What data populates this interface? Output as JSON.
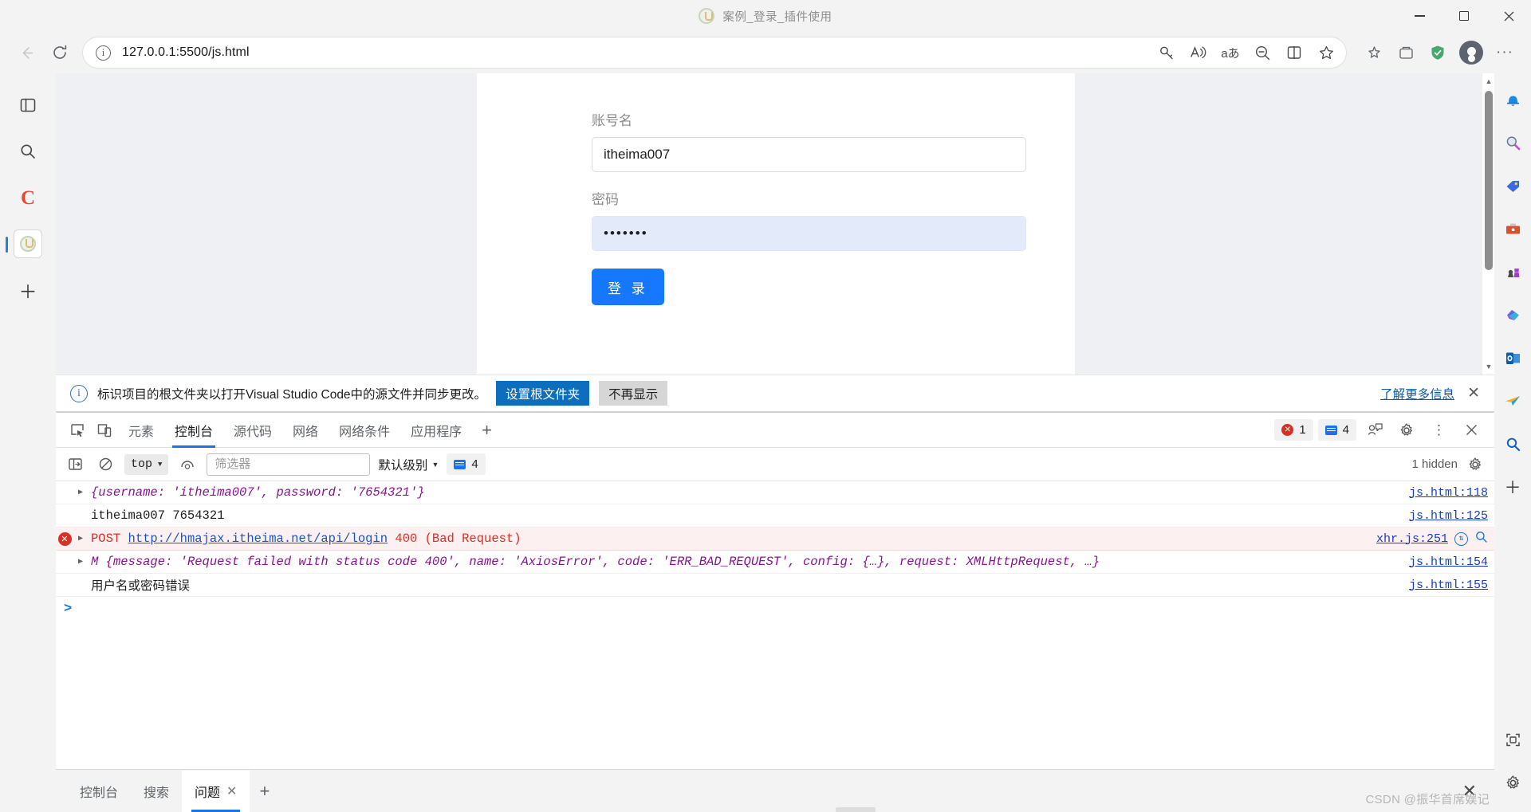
{
  "window": {
    "title": "案例_登录_插件使用",
    "favicon_name": "page-favicon",
    "minimize": "—",
    "maximize": "□",
    "close": "✕"
  },
  "navbar": {
    "back_icon": "back-arrow-icon",
    "reload_icon": "reload-icon",
    "url": "127.0.0.1:5500/js.html",
    "info_glyph": "i",
    "actions": [
      {
        "name": "password-key-icon",
        "glyph": "🔑"
      },
      {
        "name": "read-aloud-icon",
        "glyph": "A"
      },
      {
        "name": "translate-icon",
        "glyph": "aあ"
      },
      {
        "name": "zoom-out-icon",
        "glyph": "－"
      },
      {
        "name": "split-screen-icon",
        "glyph": "▯"
      },
      {
        "name": "add-favorite-icon",
        "glyph": "☆"
      }
    ],
    "right_actions": [
      {
        "name": "collections-icon",
        "glyph": "✦"
      },
      {
        "name": "browser-essentials-icon",
        "glyph": "▣"
      },
      {
        "name": "shield-icon",
        "glyph": "🛡"
      }
    ],
    "more_glyph": "···"
  },
  "left_rail": {
    "items": [
      {
        "name": "split-pane-icon",
        "glyph": "▯"
      },
      {
        "name": "search-icon",
        "glyph": "🔍"
      },
      {
        "name": "copilot-c-icon",
        "glyph": "C"
      },
      {
        "name": "site-tab-icon",
        "glyph": "●"
      },
      {
        "name": "add-tab-icon",
        "glyph": "＋"
      }
    ]
  },
  "login": {
    "username_label": "账号名",
    "username_value": "itheima007",
    "password_label": "密码",
    "password_value": "•••••••",
    "submit_label": "登 录",
    "accent_color": "#1677ff",
    "autofill_color": "#e3ebfb"
  },
  "infobar": {
    "icon": "info-icon",
    "message": "标识项目的根文件夹以打开Visual Studio Code中的源文件并同步更改。",
    "primary_button": "设置根文件夹",
    "secondary_button": "不再显示",
    "link": "了解更多信息",
    "close": "✕"
  },
  "devtools": {
    "tools": [
      {
        "name": "inspect-element-icon",
        "glyph": "⌕"
      },
      {
        "name": "device-toolbar-icon",
        "glyph": "▭"
      }
    ],
    "tabs": [
      {
        "label": "元素",
        "active": false,
        "name": "tab-elements"
      },
      {
        "label": "控制台",
        "active": true,
        "name": "tab-console"
      },
      {
        "label": "源代码",
        "active": false,
        "name": "tab-sources"
      },
      {
        "label": "网络",
        "active": false,
        "name": "tab-network"
      },
      {
        "label": "网络条件",
        "active": false,
        "name": "tab-network-conditions"
      },
      {
        "label": "应用程序",
        "active": false,
        "name": "tab-application"
      }
    ],
    "add_tab": "+",
    "error_count": "1",
    "message_count": "4",
    "feedback_icon": "feedback-icon",
    "settings_icon": "gear-icon",
    "more_icon": "⋮",
    "close_icon": "✕",
    "filterbar": {
      "sidebar_toggle": "console-sidebar-icon",
      "clear_console": "clear-console-icon",
      "context": "top",
      "eye_icon": "live-expression-icon",
      "filter_placeholder": "筛选器",
      "filter_value": "",
      "level": "默认级别",
      "level_count": "4",
      "hidden_label": "1 hidden",
      "settings_icon": "gear-icon"
    },
    "logs": [
      {
        "type": "object",
        "expandable": true,
        "text": "{username: 'itheima007', password: '7654321'}",
        "source": "js.html:118"
      },
      {
        "type": "plain",
        "expandable": false,
        "text": "itheima007 7654321",
        "source": "js.html:125"
      },
      {
        "type": "error",
        "expandable": true,
        "method": "POST",
        "url": "http://hmajax.itheima.net/api/login",
        "status": "400 (Bad Request)",
        "source": "xhr.js:251",
        "has_network_icon": true,
        "has_search_icon": true
      },
      {
        "type": "object",
        "expandable": true,
        "prefix": "M",
        "text": "{message: 'Request failed with status code 400', name: 'AxiosError', code: 'ERR_BAD_REQUEST', config: {…}, request: XMLHttpRequest, …}",
        "source": "js.html:154"
      },
      {
        "type": "cn",
        "expandable": false,
        "text": "用户名或密码错误",
        "source": "js.html:155"
      }
    ],
    "prompt": ">",
    "drawer": {
      "tabs": [
        {
          "label": "控制台",
          "active": false,
          "closable": false,
          "name": "drawer-tab-console"
        },
        {
          "label": "搜索",
          "active": false,
          "closable": false,
          "name": "drawer-tab-search"
        },
        {
          "label": "问题",
          "active": true,
          "closable": true,
          "name": "drawer-tab-issues"
        }
      ],
      "add": "+",
      "close": "✕"
    }
  },
  "right_rail": {
    "items": [
      {
        "name": "notifications-bell-icon",
        "glyph": "🔔"
      },
      {
        "name": "search-magnifier-icon",
        "glyph": "🔍"
      },
      {
        "name": "shopping-tag-icon",
        "glyph": "🏷"
      },
      {
        "name": "briefcase-tools-icon",
        "glyph": "🧰"
      },
      {
        "name": "games-chess-icon",
        "glyph": "♟"
      },
      {
        "name": "microsoft-365-icon",
        "glyph": "◆"
      },
      {
        "name": "outlook-icon",
        "glyph": "◧"
      },
      {
        "name": "telegram-plane-icon",
        "glyph": "➤"
      },
      {
        "name": "bing-search-icon",
        "glyph": "🔎"
      },
      {
        "name": "add-sidebar-app-icon",
        "glyph": "＋"
      }
    ],
    "bottom_items": [
      {
        "name": "screenshot-icon",
        "glyph": "⛶"
      },
      {
        "name": "sidebar-settings-icon",
        "glyph": "⚙"
      }
    ]
  },
  "watermark": "CSDN @振华首席娱记"
}
